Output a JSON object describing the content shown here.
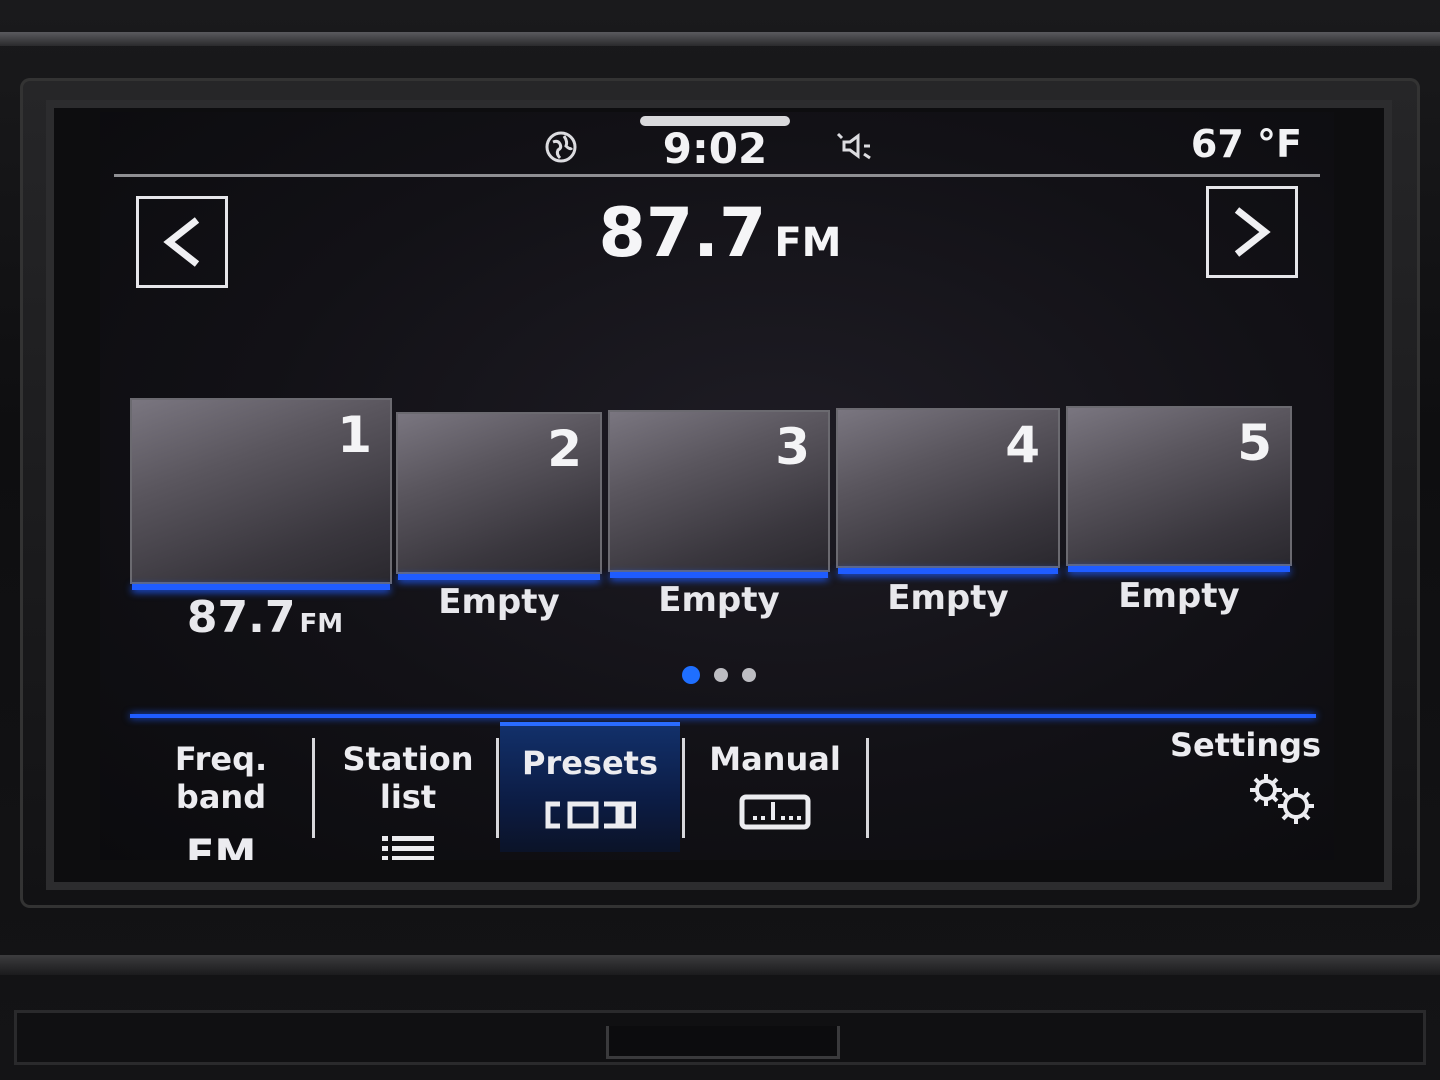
{
  "status_bar": {
    "time": "9:02",
    "temperature": "67 °F",
    "icons": [
      "globe-icon",
      "speaker-muted-icon"
    ]
  },
  "header": {
    "frequency": "87.7",
    "band": "FM",
    "prev_icon": "chevron-left-icon",
    "next_icon": "chevron-right-icon"
  },
  "presets": [
    {
      "number": "1",
      "label": "87.7",
      "label_band": "FM"
    },
    {
      "number": "2",
      "label": "Empty"
    },
    {
      "number": "3",
      "label": "Empty"
    },
    {
      "number": "4",
      "label": "Empty"
    },
    {
      "number": "5",
      "label": "Empty"
    }
  ],
  "page_indicator": {
    "pages": 3,
    "current": 1
  },
  "menu": {
    "freq_band": {
      "label": "Freq. band",
      "value": "FM"
    },
    "station_list": {
      "label": "Station list",
      "icon": "list-icon"
    },
    "presets": {
      "label": "Presets",
      "icon": "presets-icon",
      "active": true
    },
    "manual": {
      "label": "Manual",
      "icon": "tuner-scale-icon"
    },
    "settings": {
      "label": "Settings",
      "icon": "gears-icon"
    }
  },
  "colors": {
    "accent": "#1f5cff",
    "text": "#ececf0",
    "active_tab": "#12306a"
  }
}
